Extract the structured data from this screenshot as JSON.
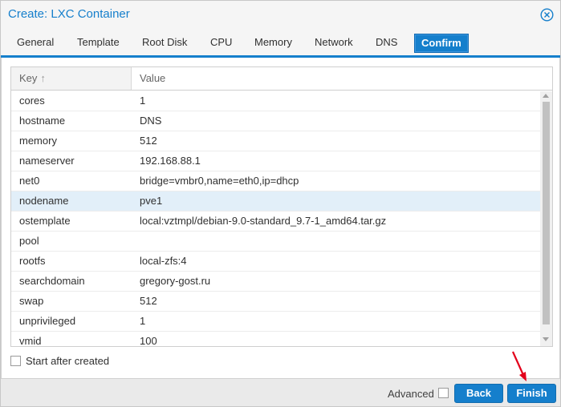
{
  "window": {
    "title": "Create: LXC Container",
    "close_icon": "close-circle-icon",
    "accent_color": "#157fcc"
  },
  "tabs": [
    {
      "label": "General"
    },
    {
      "label": "Template"
    },
    {
      "label": "Root Disk"
    },
    {
      "label": "CPU"
    },
    {
      "label": "Memory"
    },
    {
      "label": "Network"
    },
    {
      "label": "DNS"
    },
    {
      "label": "Confirm",
      "active": true
    }
  ],
  "grid": {
    "columns": {
      "key": "Key",
      "value": "Value"
    },
    "sort_icon": "sort-ascending-arrow-icon",
    "rows": [
      {
        "key": "cores",
        "value": "1"
      },
      {
        "key": "hostname",
        "value": "DNS"
      },
      {
        "key": "memory",
        "value": "512"
      },
      {
        "key": "nameserver",
        "value": "192.168.88.1"
      },
      {
        "key": "net0",
        "value": "bridge=vmbr0,name=eth0,ip=dhcp"
      },
      {
        "key": "nodename",
        "value": "pve1",
        "selected": true
      },
      {
        "key": "ostemplate",
        "value": "local:vztmpl/debian-9.0-standard_9.7-1_amd64.tar.gz"
      },
      {
        "key": "pool",
        "value": ""
      },
      {
        "key": "rootfs",
        "value": "local-zfs:4"
      },
      {
        "key": "searchdomain",
        "value": "gregory-gost.ru"
      },
      {
        "key": "swap",
        "value": "512"
      },
      {
        "key": "unprivileged",
        "value": "1"
      },
      {
        "key": "vmid",
        "value": "100"
      }
    ]
  },
  "options": {
    "start_after_created_label": "Start after created",
    "start_after_created_checked": false
  },
  "footer": {
    "advanced_label": "Advanced",
    "advanced_checked": false,
    "back_label": "Back",
    "finish_label": "Finish"
  },
  "annotation": {
    "arrow_color": "#e3001b",
    "arrow_icon": "red-arrow-pointer-icon"
  }
}
